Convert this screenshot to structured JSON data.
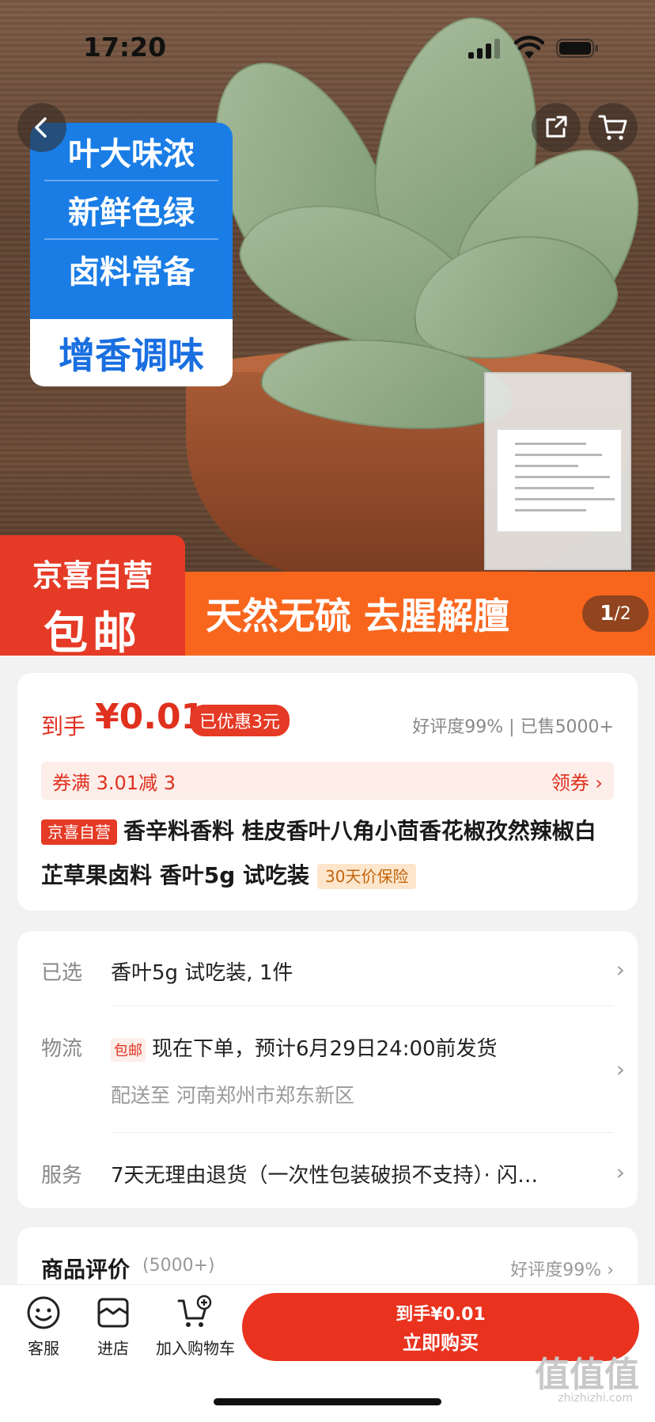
{
  "status": {
    "time": "17:20"
  },
  "hero": {
    "badge_lines": [
      "叶大味浓",
      "新鲜色绿",
      "卤料常备"
    ],
    "badge_highlight": "增香调味",
    "promo_left_top": "京喜自营",
    "promo_left_bottom": "包邮",
    "promo_right": "天然无硫  去腥解膻",
    "pager_current": "1",
    "pager_total": "/2"
  },
  "price": {
    "label": "到手",
    "value": "¥0.01",
    "discount": "已优惠3元",
    "rating": "好评度99% | 已售5000+",
    "coupon_text": "券满 3.01减 3",
    "coupon_action": "领券 ›"
  },
  "product": {
    "tag": "京喜自营",
    "title": "香辛料香料 桂皮香叶八角小茴香花椒孜然辣椒白芷草果卤料 香叶5g 试吃装",
    "guarantee": "30天价保险"
  },
  "info": {
    "selected_label": "已选",
    "selected_value": "香叶5g 试吃装, 1件",
    "logistics_label": "物流",
    "free_tag": "包邮",
    "logistics_value": "现在下单，预计6月29日24:00前发货",
    "delivery": "配送至 河南郑州市郑东新区",
    "service_label": "服务",
    "service_value": "7天无理由退货（一次性包装破损不支持）· 闪…"
  },
  "review": {
    "title": "商品评价",
    "count": "(5000+)",
    "rate": "好评度99% ›"
  },
  "bottom": {
    "service": "客服",
    "store": "进店",
    "add_cart": "加入购物车",
    "buy_line1": "到手¥0.01",
    "buy_line2": "立即购买"
  },
  "watermark": {
    "main": "值值值",
    "sub": "zhizhizhi.com"
  }
}
